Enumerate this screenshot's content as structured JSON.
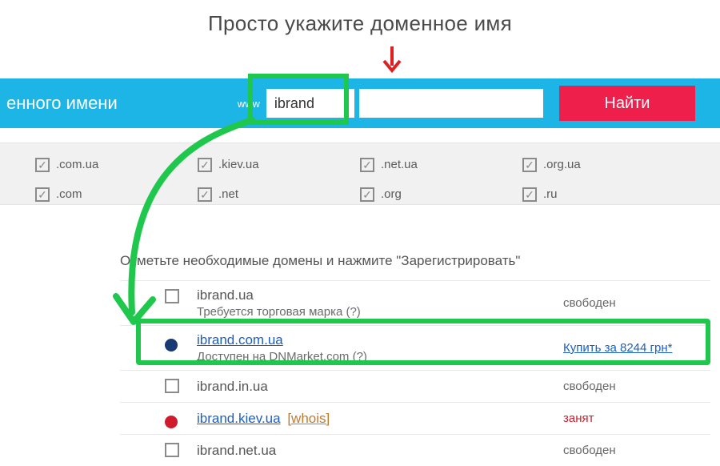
{
  "caption": "Просто укажите доменное имя",
  "search": {
    "partial_label": "енного имени",
    "www": "www",
    "input_value": "ibrand",
    "find_label": "Найти"
  },
  "tlds": [
    {
      "label": ".com.ua"
    },
    {
      "label": ".kiev.ua"
    },
    {
      "label": ".net.ua"
    },
    {
      "label": ".org.ua"
    },
    {
      "label": ".com"
    },
    {
      "label": ".net"
    },
    {
      "label": ".org"
    },
    {
      "label": ".ru"
    }
  ],
  "results_caption": "Отметьте необходимые домены и нажмите \"Зарегистрировать\"",
  "rows": [
    {
      "marker": "checkbox",
      "domain_text": "ibrand.ua",
      "domain_is_link": false,
      "sub": "Требуется торговая марка (?)",
      "status": "свободен",
      "status_style": "plain"
    },
    {
      "marker": "blue-dot",
      "domain_text": "ibrand.com.ua",
      "domain_is_link": true,
      "sub": "Доступен на DNMarket.com (?)",
      "status": "Купить за 8244 грн*",
      "status_style": "link"
    },
    {
      "marker": "checkbox",
      "domain_text": "ibrand.in.ua",
      "domain_is_link": false,
      "sub": "",
      "status": "свободен",
      "status_style": "plain"
    },
    {
      "marker": "red-dot",
      "domain_text": "ibrand.kiev.ua",
      "domain_is_link": true,
      "whois": "[whois]",
      "sub": "",
      "status": "занят",
      "status_style": "busy"
    },
    {
      "marker": "checkbox",
      "domain_text": "ibrand.net.ua",
      "domain_is_link": false,
      "sub": "",
      "status": "свободен",
      "status_style": "plain"
    }
  ]
}
